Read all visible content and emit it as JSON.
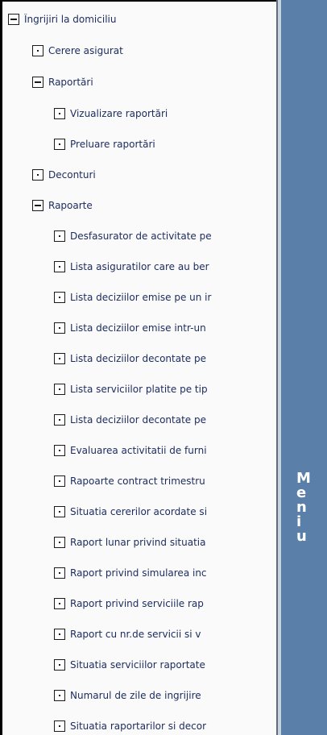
{
  "tree": {
    "root": {
      "label": "Îngrijiri la domiciliu"
    },
    "cereri": {
      "label": "Cerere asigurat"
    },
    "raportari": {
      "label": "Raportări",
      "vizualizare": "Vizualizare raportări",
      "preluare": "Preluare raportări"
    },
    "deconturi": {
      "label": "Deconturi"
    },
    "rapoarte": {
      "label": "Rapoarte",
      "items": [
        "Desfasurator de activitate pe",
        "Lista asiguratilor care au ber",
        "Lista deciziilor emise pe un ir",
        "Lista deciziilor emise intr-un",
        "Lista deciziilor decontate pe",
        "Lista serviciilor platite pe tip",
        "Lista deciziilor decontate pe",
        "Evaluarea activitatii de furni",
        "Rapoarte contract trimestru",
        "Situatia cererilor acordate si",
        "Raport lunar privind situatia",
        "Raport privind simularea inc",
        "Raport privind serviciile rap",
        "Raport cu nr.de servicii si v",
        "Situatia serviciilor raportate",
        "Numarul de zile de ingrijire",
        "Situatia raportarilor si decor"
      ]
    }
  },
  "side_panel": {
    "text": "M\ne\nn\ni\nu"
  }
}
